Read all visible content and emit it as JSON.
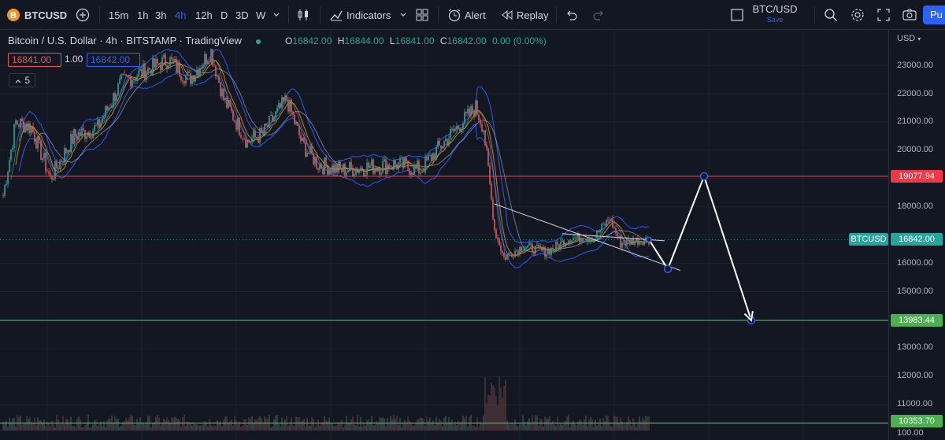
{
  "toolbar": {
    "symbol": "BTCUSD",
    "intervals": [
      "15m",
      "1h",
      "3h",
      "4h",
      "12h",
      "D",
      "3D",
      "W"
    ],
    "active_interval": "4h",
    "indicators_label": "Indicators",
    "alert_label": "Alert",
    "replay_label": "Replay",
    "layout_name": "BTC/USD",
    "layout_status": "Save",
    "publish_label": "Pu"
  },
  "legend": {
    "title": "Bitcoin / U.S. Dollar · 4h · BITSTAMP · TradingView",
    "o_label": "O",
    "o": "16842.00",
    "h_label": "H",
    "h": "16844.00",
    "l_label": "L",
    "l": "16841.00",
    "c_label": "C",
    "c": "16842.00",
    "change": "0.00 (0.00%)",
    "bid": "16841.00",
    "spread": "1.00",
    "ask": "16842.00",
    "collapsed_count": "5"
  },
  "price_axis": {
    "currency": "USD",
    "ticks": [
      "23000.00",
      "22000.00",
      "21000.00",
      "20000.00",
      "18000.00",
      "16000.00",
      "15000.00",
      "13000.00",
      "12000.00",
      "11000.00",
      "100.00"
    ],
    "resistance": "19077.94",
    "support": "13983.44",
    "last_price": "16842.00",
    "last_symbol": "BTCUSD",
    "bottom_level": "10353.70"
  },
  "colors": {
    "background": "#131722",
    "accent": "#2962ff",
    "up": "#26a69a",
    "down": "#ef5350",
    "resistance": "#f23645",
    "support": "#4caf50",
    "bands": "#2962ff",
    "projection": "#ffffff"
  },
  "chart_data": {
    "type": "line",
    "symbol": "BTCUSD",
    "interval": "4h",
    "ylim": [
      10000,
      23600
    ],
    "horizontal_levels": [
      19077.94,
      13983.44,
      10353.7
    ],
    "last_price": 16842.0,
    "price_path": [
      {
        "bar": 0,
        "y": 18400
      },
      {
        "bar": 8,
        "y": 21000
      },
      {
        "bar": 18,
        "y": 20800
      },
      {
        "bar": 30,
        "y": 19000
      },
      {
        "bar": 45,
        "y": 20500
      },
      {
        "bar": 60,
        "y": 20800
      },
      {
        "bar": 75,
        "y": 22400
      },
      {
        "bar": 90,
        "y": 22800
      },
      {
        "bar": 105,
        "y": 23200
      },
      {
        "bar": 118,
        "y": 22500
      },
      {
        "bar": 132,
        "y": 23500
      },
      {
        "bar": 140,
        "y": 21800
      },
      {
        "bar": 155,
        "y": 20300
      },
      {
        "bar": 165,
        "y": 20600
      },
      {
        "bar": 180,
        "y": 21800
      },
      {
        "bar": 190,
        "y": 20200
      },
      {
        "bar": 200,
        "y": 19500
      },
      {
        "bar": 215,
        "y": 19300
      },
      {
        "bar": 230,
        "y": 19400
      },
      {
        "bar": 250,
        "y": 19500
      },
      {
        "bar": 265,
        "y": 19300
      },
      {
        "bar": 280,
        "y": 20300
      },
      {
        "bar": 295,
        "y": 21200
      },
      {
        "bar": 300,
        "y": 21500
      },
      {
        "bar": 305,
        "y": 20800
      },
      {
        "bar": 312,
        "y": 17200
      },
      {
        "bar": 318,
        "y": 16200
      },
      {
        "bar": 330,
        "y": 16600
      },
      {
        "bar": 345,
        "y": 16400
      },
      {
        "bar": 360,
        "y": 16900
      },
      {
        "bar": 375,
        "y": 16900
      },
      {
        "bar": 385,
        "y": 17600
      },
      {
        "bar": 392,
        "y": 16700
      },
      {
        "bar": 400,
        "y": 16800
      },
      {
        "bar": 410,
        "y": 16842
      }
    ],
    "wedge_lines": [
      {
        "from": {
          "bar": 312,
          "y": 18100
        },
        "to": {
          "bar": 430,
          "y": 15750
        }
      },
      {
        "from": {
          "bar": 355,
          "y": 17050
        },
        "to": {
          "bar": 420,
          "y": 16800
        }
      }
    ],
    "projection": [
      {
        "bar": 410,
        "y": 16842
      },
      {
        "bar": 422,
        "y": 15800
      },
      {
        "bar": 445,
        "y": 19077.94
      },
      {
        "bar": 475,
        "y": 13983.44
      }
    ]
  }
}
